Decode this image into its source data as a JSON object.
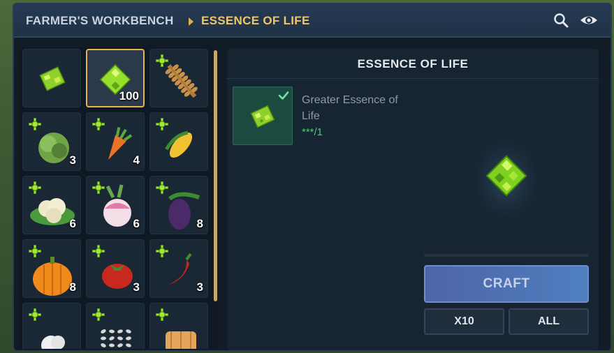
{
  "header": {
    "breadcrumb_root": "FARMER'S WORKBENCH",
    "breadcrumb_current": "ESSENCE OF LIFE",
    "search_icon": "search-icon",
    "view_icon": "eye-icon"
  },
  "grid": {
    "items": [
      {
        "name": "essence-of-life",
        "count": "",
        "badge": false,
        "selected": false
      },
      {
        "name": "greater-essence-of-life",
        "count": "100",
        "badge": false,
        "selected": true
      },
      {
        "name": "wheat",
        "count": "",
        "badge": true,
        "selected": false
      },
      {
        "name": "cabbage",
        "count": "3",
        "badge": true,
        "selected": false
      },
      {
        "name": "carrot",
        "count": "4",
        "badge": true,
        "selected": false
      },
      {
        "name": "corn",
        "count": "",
        "badge": true,
        "selected": false
      },
      {
        "name": "cauliflower",
        "count": "6",
        "badge": true,
        "selected": false
      },
      {
        "name": "turnip",
        "count": "6",
        "badge": true,
        "selected": false
      },
      {
        "name": "eggplant",
        "count": "8",
        "badge": true,
        "selected": false
      },
      {
        "name": "pumpkin",
        "count": "8",
        "badge": true,
        "selected": false
      },
      {
        "name": "tomato",
        "count": "3",
        "badge": true,
        "selected": false
      },
      {
        "name": "chili-pepper",
        "count": "3",
        "badge": true,
        "selected": false
      },
      {
        "name": "cotton",
        "count": "",
        "badge": true,
        "selected": false
      },
      {
        "name": "seeds",
        "count": "",
        "badge": true,
        "selected": false
      },
      {
        "name": "bread",
        "count": "",
        "badge": true,
        "selected": false
      }
    ]
  },
  "detail": {
    "title": "ESSENCE OF LIFE",
    "ingredient": {
      "name": "Greater Essence of Life",
      "quantity": "***/1",
      "check_icon": "check-icon"
    },
    "craft_label": "CRAFT",
    "x10_label": "X10",
    "all_label": "ALL"
  },
  "colors": {
    "accent_gold": "#f0c766",
    "essence_green": "#9be22b",
    "craft_blue": "#4f7fbf",
    "ok_green": "#4fc77a"
  }
}
